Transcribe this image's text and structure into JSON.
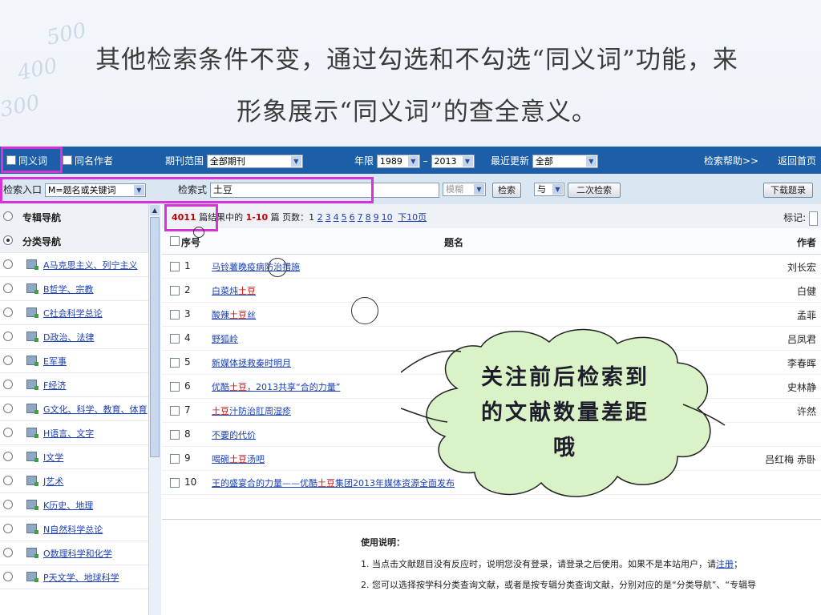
{
  "slide": {
    "title_line1": "其他检索条件不变，通过勾选和不勾选“同义词”功能，来",
    "title_line2": "形象展示“同义词”的查全意义。",
    "deco_numbers": [
      "500",
      "400",
      "300"
    ]
  },
  "toolbar": {
    "synonym_label": "同义词",
    "same_author_label": "同名作者",
    "journal_range_label": "期刊范围",
    "journal_range_value": "全部期刊",
    "year_label": "年限",
    "year_from": "1989",
    "year_dash": "–",
    "year_to": "2013",
    "recent_update_label": "最近更新",
    "recent_update_value": "全部",
    "help_link": "检索帮助>>",
    "home_link": "返回首页"
  },
  "searchbar": {
    "entry_label": "检索入口",
    "entry_value": "M=题名或关键词",
    "expr_label": "检索式",
    "expr_value": "土豆",
    "fuzzy_value": "模糊",
    "search_button": "检索",
    "and_value": "与",
    "secondary_search_button": "二次检索",
    "download_button": "下载题录"
  },
  "sidebar": {
    "items": [
      {
        "label": "专辑导航",
        "header": true,
        "selected": false
      },
      {
        "label": "分类导航",
        "header": true,
        "selected": true
      },
      {
        "label": "A马克思主义、列宁主义"
      },
      {
        "label": "B哲学、宗教"
      },
      {
        "label": "C社会科学总论"
      },
      {
        "label": "D政治、法律"
      },
      {
        "label": "E军事"
      },
      {
        "label": "F经济"
      },
      {
        "label": "G文化、科学、教育、体育"
      },
      {
        "label": "H语言、文字"
      },
      {
        "label": "I文学"
      },
      {
        "label": "J艺术"
      },
      {
        "label": "K历史、地理"
      },
      {
        "label": "N自然科学总论"
      },
      {
        "label": "O数理科学和化学"
      },
      {
        "label": "P天文学、地球科学"
      }
    ]
  },
  "results": {
    "count": "4011",
    "count_suffix": "篇结果中的",
    "range": "1-10",
    "range_suffix": "篇 页数：1",
    "pages": [
      "2",
      "3",
      "4",
      "5",
      "6",
      "7",
      "8",
      "9",
      "10"
    ],
    "next10": "下10页",
    "mark_label": "标记:",
    "col_no": "序号",
    "col_title": "题名",
    "col_author": "作者",
    "rows": [
      {
        "no": "1",
        "title": [
          {
            "t": "马铃薯晚疫病防治措施"
          }
        ],
        "author": "刘长宏"
      },
      {
        "no": "2",
        "title": [
          {
            "t": "白菜炖"
          },
          {
            "t": "土豆",
            "kw": true
          }
        ],
        "author": "白健"
      },
      {
        "no": "3",
        "title": [
          {
            "t": "酸辣"
          },
          {
            "t": "土豆",
            "kw": true
          },
          {
            "t": "丝"
          }
        ],
        "author": "孟菲"
      },
      {
        "no": "4",
        "title": [
          {
            "t": "野狐岭"
          }
        ],
        "author": "吕凤君"
      },
      {
        "no": "5",
        "title": [
          {
            "t": "新媒体拯救秦时明月"
          }
        ],
        "author": "李春晖"
      },
      {
        "no": "6",
        "title": [
          {
            "t": "优酷"
          },
          {
            "t": "土豆",
            "kw": true
          },
          {
            "t": "，2013共享“合的力量”"
          }
        ],
        "author": "史林静"
      },
      {
        "no": "7",
        "title": [
          {
            "t": "土豆",
            "kw": true
          },
          {
            "t": "汁防治肛周湿疹"
          }
        ],
        "author": "许然"
      },
      {
        "no": "8",
        "title": [
          {
            "t": "不要的代价"
          }
        ],
        "author": ""
      },
      {
        "no": "9",
        "title": [
          {
            "t": "喝碗"
          },
          {
            "t": "土豆",
            "kw": true
          },
          {
            "t": "汤吧"
          }
        ],
        "author": "吕红梅 赤卧"
      },
      {
        "no": "10",
        "title": [
          {
            "t": "王的盛宴合的力量——优酷"
          },
          {
            "t": "土豆",
            "kw": true
          },
          {
            "t": "集团2013年媒体资源全面发布"
          }
        ],
        "author": ""
      }
    ]
  },
  "usage": {
    "heading": "使用说明：",
    "line1_prefix": "1. 当点击文献题目没有反应时，说明您没有登录，请登录之后使用。如果不是本站用户，请",
    "line1_link": "注册",
    "line1_suffix": "；",
    "line2": "2. 您可以选择按学科分类查询文献，或者是按专辑分类查询文献，分别对应的是“分类导航”、“专辑导"
  },
  "callout": {
    "line1": "关注前后检索到",
    "line2": "的文献数量差距",
    "line3": "哦"
  },
  "colors": {
    "toolbar_blue": "#1c5ea8",
    "highlight_magenta": "#d632d6",
    "keyword_red": "#e00000",
    "link_blue": "#1a3fb8",
    "cloud_fill": "#d9f2c7"
  }
}
